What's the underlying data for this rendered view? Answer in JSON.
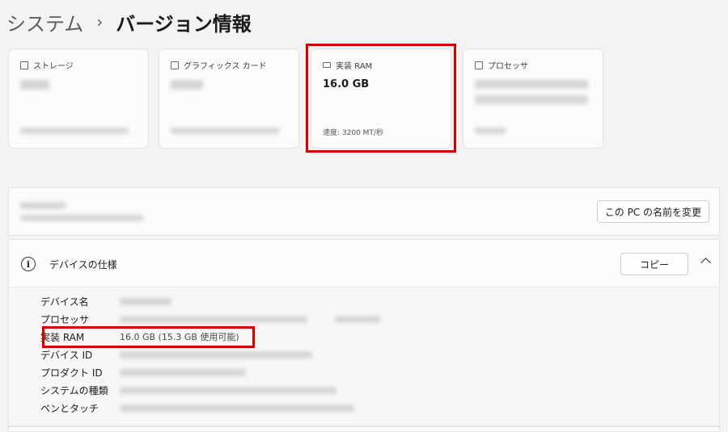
{
  "breadcrumb": {
    "parent": "システム",
    "separator": "›",
    "current": "バージョン情報"
  },
  "cards": {
    "storage": {
      "label": "ストレージ",
      "icon": "storage-icon"
    },
    "graphics": {
      "label": "グラフィックス カード",
      "icon": "graphics-card-icon"
    },
    "ram": {
      "label": "実装 RAM",
      "value": "16.0 GB",
      "sub": "速度: 3200 MT/秒",
      "icon": "ram-icon"
    },
    "processor": {
      "label": "プロセッサ",
      "icon": "processor-icon"
    }
  },
  "device": {
    "rename_button": "この PC の名前を変更"
  },
  "specs": {
    "title": "デバイスの仕様",
    "copy_button": "コピー",
    "rows": [
      {
        "label": "デバイス名"
      },
      {
        "label": "プロセッサ"
      },
      {
        "label": "実装 RAM",
        "value": "16.0 GB (15.3 GB 使用可能)"
      },
      {
        "label": "デバイス ID"
      },
      {
        "label": "プロダクト ID"
      },
      {
        "label": "システムの種類"
      },
      {
        "label": "ペンとタッチ"
      }
    ]
  },
  "colors": {
    "highlight": "#d40000",
    "background": "#f3f3f3",
    "card": "#fbfbfb"
  }
}
